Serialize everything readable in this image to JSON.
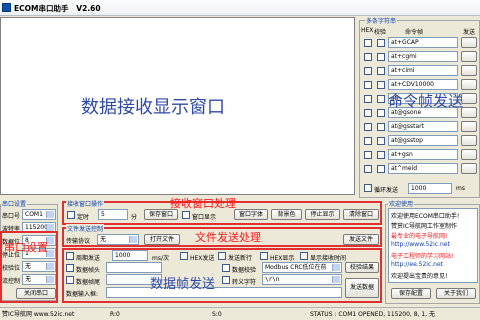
{
  "window": {
    "title": "ECOM串口助手   V2.60"
  },
  "receive_area": {
    "overlay": "数据接收显示窗口"
  },
  "multi_send": {
    "label": "多条字符串",
    "col_hex": "HEX",
    "col_check": "校验",
    "col_cmd": "命令帧",
    "col_send": "发送",
    "overlay": "命令帧发送",
    "rows": [
      {
        "cmd": "at+GCAP"
      },
      {
        "cmd": "at+cgmi"
      },
      {
        "cmd": "at+cimi"
      },
      {
        "cmd": "at+CDV10000"
      },
      {
        "cmd": "ath"
      },
      {
        "cmd": "at@gsone"
      },
      {
        "cmd": "at@gsstart"
      },
      {
        "cmd": "at@gsstop"
      },
      {
        "cmd": "at+gsn"
      },
      {
        "cmd": "at^meid"
      }
    ],
    "loop_label": "循环发送",
    "loop_value": "1000",
    "loop_unit": "ms"
  },
  "port_settings": {
    "label": "串口设置",
    "overlay": "串口设置",
    "port_label": "串口号",
    "port_value": "COM1",
    "baud_label": "波特率",
    "baud_value": "115200",
    "databits_label": "数据位",
    "databits_value": "8",
    "stopbits_label": "停止位",
    "stopbits_value": "1",
    "parity_label": "校验位",
    "parity_value": "无",
    "flow_label": "流控制",
    "flow_value": "无",
    "close_button": "关闭串口"
  },
  "receive_control": {
    "label": "接收窗口操作",
    "overlay": "接收窗口处理",
    "timer_label": "定时",
    "timer_value": "5",
    "timer_unit": "分",
    "save_window": "保存窗口",
    "window_show": "窗口显示",
    "window_font": "窗口字体",
    "background": "背景色",
    "stop_display": "停止显示",
    "clear_window": "清除窗口"
  },
  "file_send": {
    "label": "文件发送控制",
    "protocol_label": "传输协议",
    "protocol_value": "无",
    "open_file": "打开文件",
    "overlay": "文件发送处理",
    "send_file": "发送文件"
  },
  "frame_send": {
    "periodic_label": "周期发送",
    "period_value": "1000",
    "period_unit": "ms/次",
    "hex_send": "HEX发送",
    "send_newline": "发送新行",
    "hex_display": "HEX显示",
    "timestamp": "显示接收时间",
    "header_label": "数据帧头",
    "tail_label": "数据帧尾",
    "checksum_label": "数据校验",
    "checksum_value": "Modbus CRC低位在前",
    "calc_button": "校验结果",
    "escape_label": "转义字符",
    "escape_value": "\\r\\n",
    "input_label": "数据输入框:",
    "overlay": "数据帧发送",
    "send_button": "发送数据"
  },
  "welcome": {
    "label": "欢迎使用",
    "lines": [
      "欢迎使用ECOM串口助手!",
      "赞赏IC导航网工作室制作",
      "最专业的电子导航网!",
      "http://www.52ic.net",
      "电子工程师的学习网站!",
      "http://ee.52ic.net",
      "欢迎提出宝贵的意见!"
    ],
    "save_config": "保存配置",
    "about": "关于我们"
  },
  "status": {
    "site": "赞IC导航网 www.52ic.net",
    "rx": "R:0",
    "tx": "S:0",
    "port_status": "STATUS : COM1 OPENED, 115200, 8, 1, 无"
  },
  "colors": {
    "accent_red": "#e03030",
    "label_blue": "#0b3fb0",
    "overlay_blue": "#2f4aa8"
  }
}
